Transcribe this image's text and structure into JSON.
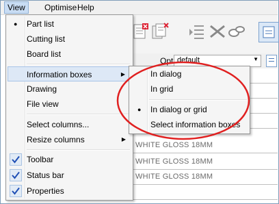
{
  "menubar": {
    "items": [
      "View",
      "Optimise",
      "Help"
    ]
  },
  "option_row": {
    "label": "Opt",
    "value": "default"
  },
  "view_menu": {
    "items": [
      {
        "label": "Part list",
        "bullet": true
      },
      {
        "label": "Cutting list"
      },
      {
        "label": "Board list"
      },
      {
        "label": "Information boxes",
        "submenu": true,
        "highlighted": true
      },
      {
        "label": "Drawing"
      },
      {
        "label": "File view"
      },
      {
        "label": "Select columns..."
      },
      {
        "label": "Resize columns",
        "submenu": true
      },
      {
        "label": "Toolbar",
        "checked": true
      },
      {
        "label": "Status bar",
        "checked": true
      },
      {
        "label": "Properties",
        "checked": true
      }
    ]
  },
  "submenu": {
    "items": [
      {
        "label": "In dialog"
      },
      {
        "label": "In grid"
      },
      {
        "label": "In dialog or grid",
        "bullet": true
      },
      {
        "label": "Select information boxes"
      }
    ]
  },
  "grid": {
    "rows": [
      "WHITE GLOSS 18MM",
      "WHITE GLOSS 18MM",
      "WHITE GLOSS 18MM"
    ]
  },
  "colors": {
    "annotation": "#e02020",
    "highlight": "#dde8f6",
    "check": "#1f4fb5"
  }
}
